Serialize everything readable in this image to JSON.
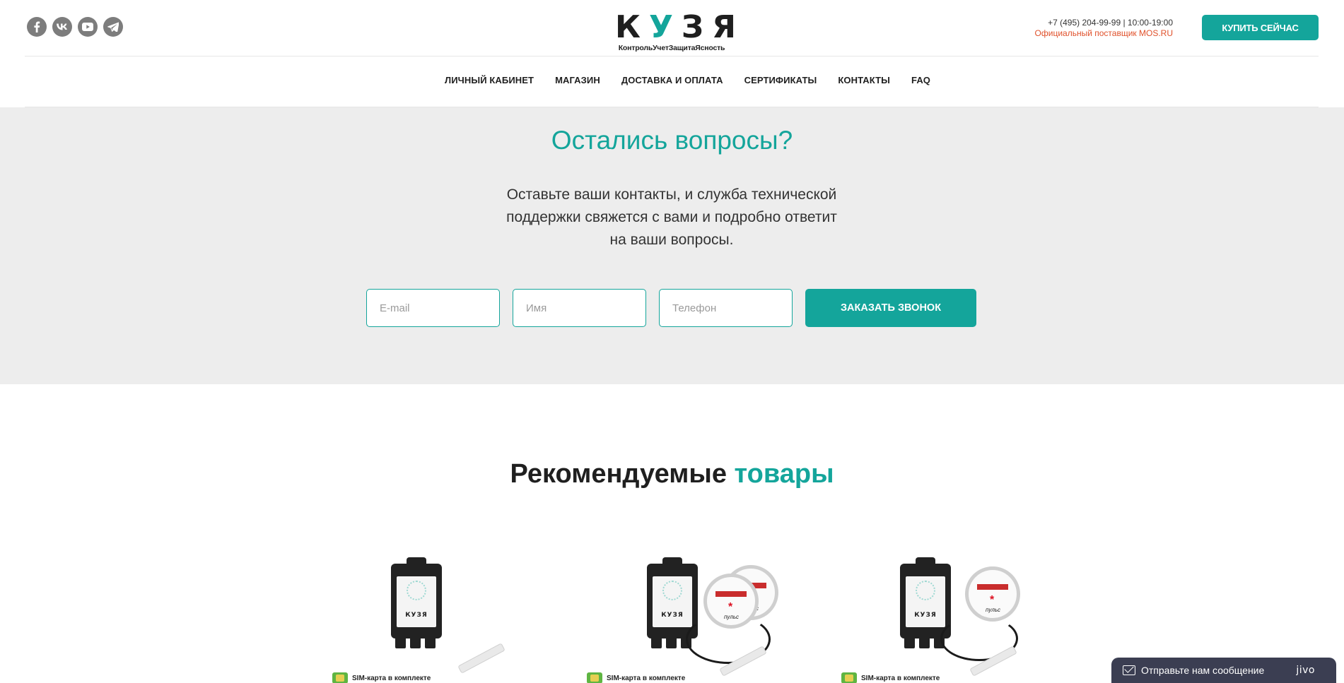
{
  "header": {
    "socials": [
      {
        "name": "facebook-icon",
        "glyph": "f"
      },
      {
        "name": "vk-icon",
        "glyph": "vk"
      },
      {
        "name": "youtube-icon",
        "glyph": "yt"
      },
      {
        "name": "telegram-icon",
        "glyph": "tg"
      }
    ],
    "logo": {
      "word_part1": "К",
      "word_accent": "У",
      "word_part2": "ЗЯ",
      "tagline": "КонтрольУчетЗащитаЯсность"
    },
    "contact": {
      "phone": "+7 (495) 204-99-99 | 10:00-19:00",
      "supplier": "Официальный поставщик MOS.RU"
    },
    "buy_button": "КУПИТЬ СЕЙЧАС",
    "nav": [
      "ЛИЧНЫЙ КАБИНЕТ",
      "МАГАЗИН",
      "ДОСТАВКА И ОПЛАТА",
      "СЕРТИФИКАТЫ",
      "КОНТАКТЫ",
      "FAQ"
    ]
  },
  "questions": {
    "title": "Остались вопросы?",
    "text_line1": "Оставьте ваши контакты, и служба технической",
    "text_line2": "поддержки свяжется с вами и подробно ответит",
    "text_line3": "на ваши вопросы.",
    "email_placeholder": "E-mail",
    "name_placeholder": "Имя",
    "phone_placeholder": "Телефон",
    "call_button": "ЗАКАЗАТЬ ЗВОНОК"
  },
  "recommended": {
    "title_part1": "Рекомендуемые",
    "title_accent": "товары",
    "products": [
      {
        "sim_text": "SIM-карта в комплекте",
        "brand": "КУЗЯ"
      },
      {
        "sim_text": "SIM-карта в комплекте",
        "brand": "КУЗЯ"
      },
      {
        "sim_text": "SIM-карта в комплекте",
        "brand": "КУЗЯ"
      }
    ]
  },
  "chat": {
    "label": "Отправьте нам сообщение",
    "brand": "jivo"
  },
  "colors": {
    "accent": "#14a59b",
    "supplier_text": "#e0512b",
    "section_bg": "#ededed",
    "chat_bg": "#3b3e52"
  }
}
